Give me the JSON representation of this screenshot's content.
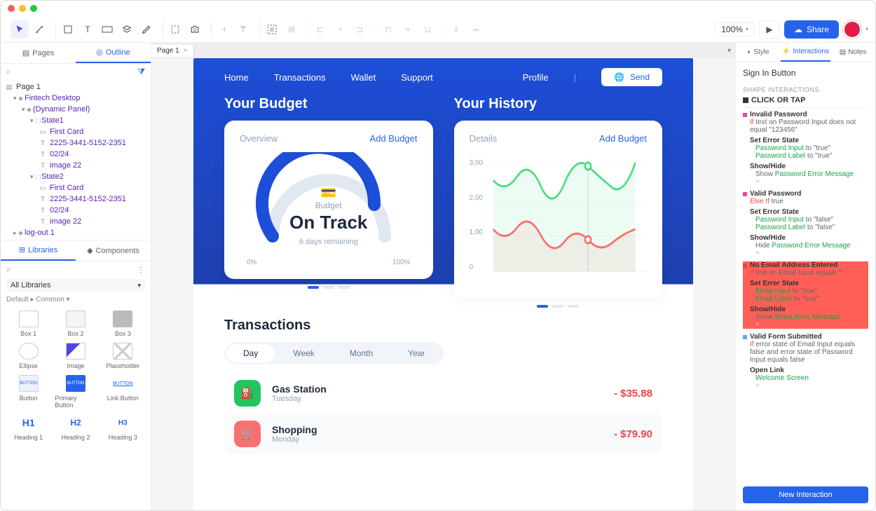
{
  "toolbar": {
    "zoom": "100%",
    "share": "Share"
  },
  "leftTabs": {
    "pages": "Pages",
    "outline": "Outline"
  },
  "tree": {
    "page1": "Page 1",
    "root": "Fintech Desktop",
    "dynamic": "(Dynamic Panel)",
    "state1": "State1",
    "state2": "State2",
    "firstCard": "First Card",
    "cardnum": "2225-3441-5152-2351",
    "date": "02/24",
    "img": "image 22",
    "logout": "log-out 1"
  },
  "libTabs": {
    "libraries": "Libraries",
    "components": "Components"
  },
  "libSelect": "All Libraries",
  "libHeader": "Default ▸ Common ▾",
  "widgets": [
    "Box 1",
    "Box 2",
    "Box 3",
    "Ellipse",
    "Image",
    "Placeholder",
    "Button",
    "Primary Button",
    "Link Button",
    "Heading 1",
    "Heading 2",
    "Heading 3"
  ],
  "wicons": [
    "H1",
    "H2",
    "H3"
  ],
  "pageTab": "Page 1",
  "nav": {
    "home": "Home",
    "trans": "Transactions",
    "wallet": "Wallet",
    "support": "Support",
    "profile": "Profile",
    "send": "Send"
  },
  "budget": {
    "title": "Your Budget",
    "overview": "Overview",
    "add": "Add Budget",
    "label": "Budget",
    "status": "On Track",
    "sub": "6 days remaining",
    "min": "0%",
    "max": "100%"
  },
  "history": {
    "title": "Your History",
    "details": "Details",
    "add": "Add Budget",
    "ticks": [
      "3,00",
      "2,00",
      "1,00",
      "0"
    ]
  },
  "transactions": {
    "title": "Transactions",
    "seg": [
      "Day",
      "Week",
      "Month",
      "Year"
    ],
    "rows": [
      {
        "icon": "⛽",
        "color": "#22c55e",
        "name": "Gas Station",
        "day": "Tuesday",
        "amt": "- $35.88"
      },
      {
        "icon": "🛒",
        "color": "#f87171",
        "name": "Shopping",
        "day": "Monday",
        "amt": "- $79.90"
      }
    ]
  },
  "rightTabs": {
    "style": "Style",
    "inter": "Interactions",
    "notes": "Notes"
  },
  "sel": "Sign In Button",
  "shapeInt": "SHAPE INTERACTIONS",
  "event": "CLICK OR TAP",
  "cases": {
    "c1": {
      "t": "Invalid Password",
      "c1a": "If",
      "c1b": " text on Password Input does not equal \"123456\"",
      "set": "Set Error State",
      "l1a": "Password Input",
      "l1b": " to \"true\"",
      "l2a": "Password Label",
      "l2b": " to \"true\"",
      "sh": "Show/Hide",
      "sh1a": "Show ",
      "sh1b": "Password Error Message"
    },
    "c2": {
      "t": "Valid Password",
      "c2a": "Else If",
      "c2b": " true",
      "set": "Set Error State",
      "l1a": "Password Input",
      "l1b": " to \"false\"",
      "l2a": "Password Label",
      "l2b": " to \"false\"",
      "sh": "Show/Hide",
      "sh1a": "Hide ",
      "sh1b": "Password Error Message"
    },
    "c3": {
      "t": "No Email Address Entered",
      "c3a": "If",
      "c3b": " text on Email Input equals \"\"",
      "set": "Set Error State",
      "l1a": "Email Input",
      "l1b": " to \"true\"",
      "l2a": "Email Label",
      "l2b": " to \"true\"",
      "sh": "Show/Hide",
      "sh1a": "Show ",
      "sh1b": "Email Error Message"
    },
    "c4": {
      "t": "Valid Form Submitted",
      "c4a": "If",
      "c4b": " error state of Email Input equals false and error state of Password Input equals false",
      "ol": "Open Link",
      "ws": "Welcome Screen"
    }
  },
  "newInt": "New Interaction",
  "chart_data": [
    {
      "type": "gauge",
      "title": "Budget",
      "status": "On Track",
      "sub": "6 days remaining",
      "value_pct": 85,
      "range": [
        0,
        100
      ]
    },
    {
      "type": "line",
      "x": [
        0,
        1,
        2,
        3,
        4,
        5,
        6,
        7,
        8,
        9
      ],
      "series": [
        {
          "name": "green",
          "color": "#4ade80",
          "values": [
            2.6,
            2.3,
            2.9,
            2.5,
            2.7,
            2.5,
            3.0,
            2.5,
            2.8,
            3.2
          ]
        },
        {
          "name": "red",
          "color": "#f87171",
          "values": [
            1.3,
            1.0,
            1.4,
            1.1,
            1.2,
            0.9,
            1.0,
            1.2,
            1.0,
            1.3
          ]
        }
      ],
      "yticks": [
        0,
        1,
        2,
        3
      ],
      "ylim": [
        0,
        3.5
      ],
      "marker_x": 6
    }
  ]
}
